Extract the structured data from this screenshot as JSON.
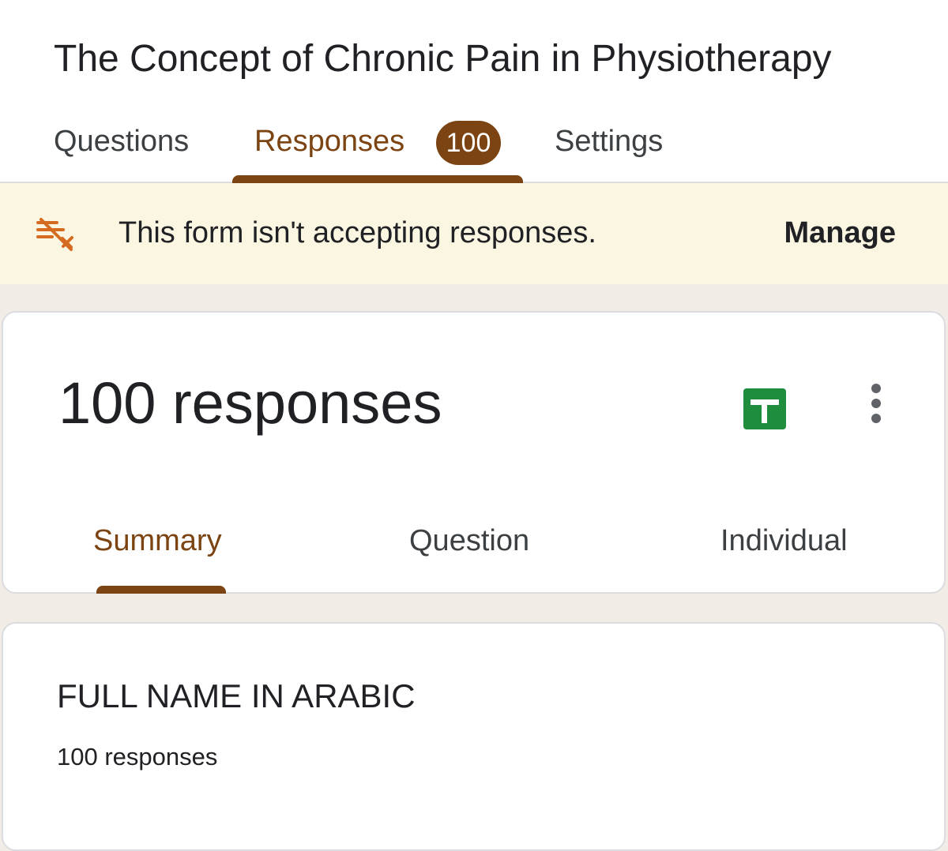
{
  "form": {
    "title": "The Concept of Chronic Pain in Physiotherapy"
  },
  "tabs": {
    "questions": "Questions",
    "responses": "Responses",
    "response_badge": "100",
    "settings": "Settings"
  },
  "banner": {
    "message": "This form isn't accepting responses.",
    "action": "Manage",
    "icon": "responses-off-icon"
  },
  "summary": {
    "count_label": "100 responses",
    "actions": {
      "sheets_icon": "google-sheets-icon",
      "more_icon": "more-vert-icon"
    },
    "tabs": {
      "summary": "Summary",
      "question": "Question",
      "individual": "Individual"
    },
    "selected_tab": "Summary"
  },
  "question_card": {
    "title": "FULL NAME IN ARABIC",
    "responses": "100 responses"
  },
  "colors": {
    "accent": "#7b4412",
    "banner_background": "#fbf6e2",
    "banner_icon": "#d56a21",
    "sheets_green": "#1e8e3e",
    "page_background": "#f1ece6"
  }
}
